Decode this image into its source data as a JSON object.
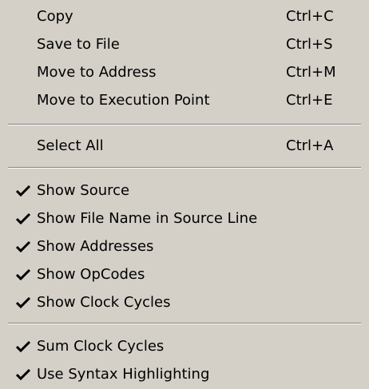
{
  "menu": {
    "items": [
      {
        "label": "Copy",
        "shortcut": "Ctrl+C"
      },
      {
        "label": "Save to File",
        "shortcut": "Ctrl+S"
      },
      {
        "label": "Move to Address",
        "shortcut": "Ctrl+M"
      },
      {
        "label": "Move to Execution Point",
        "shortcut": "Ctrl+E"
      },
      {
        "label": "Select All",
        "shortcut": "Ctrl+A"
      },
      {
        "label": "Show Source",
        "checked": true
      },
      {
        "label": "Show File Name in Source Line",
        "checked": true
      },
      {
        "label": "Show Addresses",
        "checked": true
      },
      {
        "label": "Show OpCodes",
        "checked": true
      },
      {
        "label": "Show Clock Cycles",
        "checked": true
      },
      {
        "label": "Sum Clock Cycles",
        "checked": true
      },
      {
        "label": "Use Syntax Highlighting",
        "checked": true
      }
    ],
    "check_icon": "checkmark-icon"
  }
}
